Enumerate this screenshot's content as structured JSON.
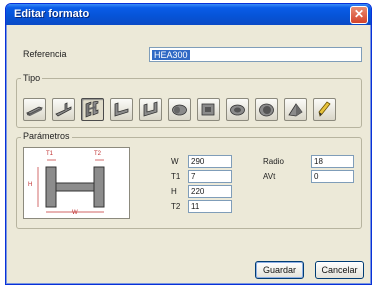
{
  "window": {
    "title": "Editar formato",
    "close_glyph": "✕"
  },
  "referencia": {
    "label": "Referencia",
    "value": "HEA300"
  },
  "tipo": {
    "legend": "Tipo",
    "buttons": [
      {
        "icon": "flat-plate-icon"
      },
      {
        "icon": "t-section-icon"
      },
      {
        "icon": "h-section-icon",
        "active": true
      },
      {
        "icon": "l-angle-icon"
      },
      {
        "icon": "u-channel-icon"
      },
      {
        "icon": "round-bar-icon"
      },
      {
        "icon": "square-tube-icon"
      },
      {
        "icon": "oval-tube-icon"
      },
      {
        "icon": "round-tube-icon"
      },
      {
        "icon": "solid-triangle-icon"
      },
      {
        "icon": "pencil-icon"
      }
    ]
  },
  "parametros": {
    "legend": "Parámetros",
    "fields": [
      {
        "label": "W",
        "value": "290"
      },
      {
        "label": "T1",
        "value": "7"
      },
      {
        "label": "H",
        "value": "220"
      },
      {
        "label": "T2",
        "value": "11"
      },
      {
        "label": "Radio",
        "value": "18"
      },
      {
        "label": "AVt",
        "value": "0"
      }
    ],
    "diagram_labels": {
      "w": "W",
      "t1": "T1",
      "t2": "T2",
      "h": "H"
    }
  },
  "buttons": {
    "save": "Guardar",
    "cancel": "Cancelar"
  },
  "colors": {
    "title_bar": "#0654d8",
    "dialog_bg": "#ece9d8",
    "selection": "#316ac5"
  }
}
